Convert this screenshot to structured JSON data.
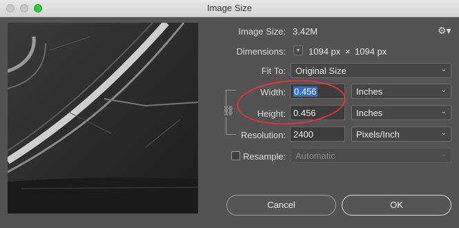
{
  "window": {
    "title": "Image Size"
  },
  "image_size": {
    "label": "Image Size:",
    "value": "3.42M"
  },
  "dimensions": {
    "label": "Dimensions:",
    "width": "1094 px",
    "separator": "×",
    "height": "1094 px"
  },
  "fit_to": {
    "label": "Fit To:",
    "value": "Original Size"
  },
  "width": {
    "label": "Width:",
    "value": "0.456",
    "unit": "Inches"
  },
  "height": {
    "label": "Height:",
    "value": "0.456",
    "unit": "Inches"
  },
  "resolution": {
    "label": "Resolution:",
    "value": "2400",
    "unit": "Pixels/Inch"
  },
  "resample": {
    "label": "Resample:",
    "checked": false,
    "value": "Automatic"
  },
  "buttons": {
    "cancel": "Cancel",
    "ok": "OK"
  },
  "icons": {
    "gear": "gear-icon",
    "chain": "link-chain-icon",
    "chevron": "chevron-down-icon"
  },
  "colors": {
    "annotation": "#e6323a",
    "selection": "#2c6fd1"
  }
}
